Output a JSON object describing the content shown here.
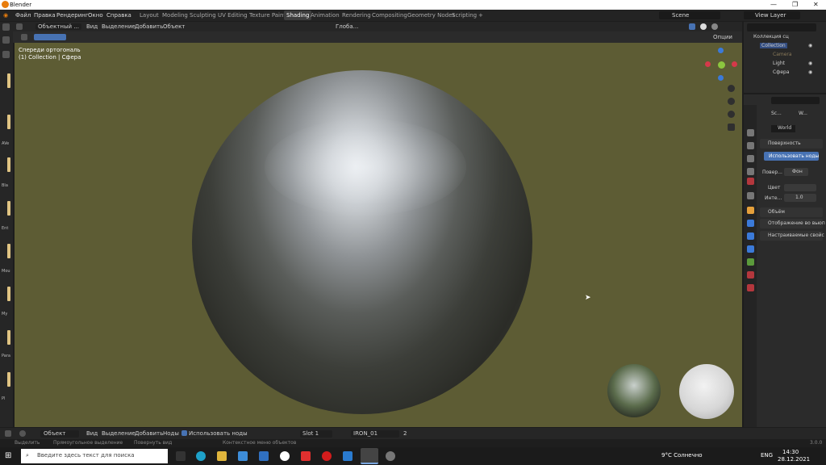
{
  "titlebar": {
    "title": "Blender",
    "min": "—",
    "max": "❐",
    "close": "✕"
  },
  "menu": {
    "items": [
      "Файл",
      "Правка",
      "Рендеринг",
      "Окно",
      "Справка"
    ],
    "workspaces": [
      "Layout",
      "Modeling",
      "Sculpting",
      "UV Editing",
      "Texture Paint",
      "Shading",
      "Animation",
      "Rendering",
      "Compositing",
      "Geometry Nodes",
      "Scripting",
      "+"
    ],
    "scene": "Scene",
    "viewlayer": "View Layer"
  },
  "viewport_header": {
    "mode": "Объектный ...",
    "menus": [
      "Вид",
      "Выделение",
      "Добавить",
      "Объект"
    ],
    "orientation": "Глоба...",
    "options": "Опции"
  },
  "viewport": {
    "view_name": "Спереди ортогональ",
    "collection_info": "(1) Collection | Сфера"
  },
  "left_panel": {
    "labels": [
      "AVe",
      "Bla",
      "Ent",
      "Mou",
      "My",
      "Para",
      "Pl"
    ]
  },
  "outliner": {
    "root": "Коллекция сц",
    "collection": "Collection",
    "objects": [
      "Camera",
      "Light",
      "Сфера"
    ]
  },
  "properties": {
    "scene_short": "Sc...",
    "world_short": "W...",
    "world_name": "World",
    "surface": "Поверхность",
    "use_nodes": "Использовать ноды",
    "surface_label": "Повер...",
    "surface_value": "Фон",
    "color_label": "Цвет",
    "strength_label": "Инте...",
    "strength_value": "1.0",
    "volume": "Объём",
    "viewport_display": "Отображение во вьюп",
    "custom_props": "Настраиваемые свойс"
  },
  "shader_header": {
    "mode": "Объект",
    "menus": [
      "Вид",
      "Выделение",
      "Добавить",
      "Ноды"
    ],
    "use_nodes": "Использовать ноды",
    "slot": "Slot 1",
    "material": "IRON_01",
    "users": "2"
  },
  "statusbar": {
    "select": "Выделить",
    "box": "Прямоугольное выделение",
    "rotate": "Повернуть вид",
    "context": "Контекстное меню объектов",
    "version": "3.0.0"
  },
  "taskbar": {
    "search_placeholder": "Введите здесь текст для поиска",
    "weather": "9°C  Солнечно",
    "lang": "ENG",
    "time": "14:30",
    "date": "28.12.2021"
  },
  "colors": {
    "viewport_bg": "#5d5c34",
    "accent": "#e87d0d",
    "button_blue": "#4772b3"
  }
}
